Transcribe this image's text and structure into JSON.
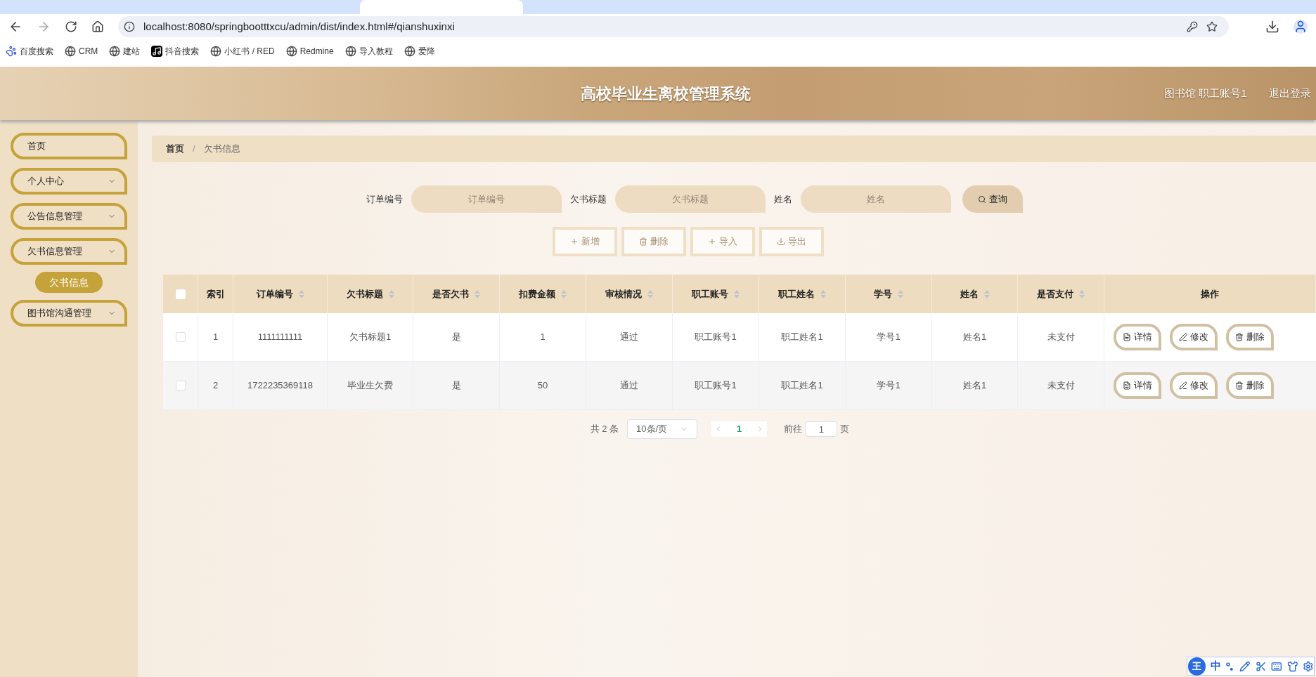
{
  "browser": {
    "url": "localhost:8080/springbootttxcu/admin/dist/index.html#/qianshuxinxi",
    "bookmarks": [
      {
        "kind": "paw",
        "label": "百度搜索"
      },
      {
        "kind": "globe",
        "label": "CRM"
      },
      {
        "kind": "globe",
        "label": "建站"
      },
      {
        "kind": "note",
        "label": "抖音搜索"
      },
      {
        "kind": "globe",
        "label": "小红书 / RED"
      },
      {
        "kind": "globe",
        "label": "Redmine"
      },
      {
        "kind": "globe",
        "label": "导入教程"
      },
      {
        "kind": "globe",
        "label": "爱降"
      }
    ]
  },
  "header": {
    "title": "高校毕业生离校管理系统",
    "user": "图书馆 职工账号1",
    "logout": "退出登录"
  },
  "sidebar": {
    "items": [
      {
        "label": "首页",
        "kind": "link"
      },
      {
        "label": "个人中心",
        "kind": "submenu"
      },
      {
        "label": "公告信息管理",
        "kind": "submenu"
      },
      {
        "label": "欠书信息管理",
        "kind": "submenu",
        "children": [
          {
            "label": "欠书信息",
            "selected": true
          }
        ]
      },
      {
        "label": "图书馆沟通管理",
        "kind": "submenu"
      }
    ]
  },
  "breadcrumb": {
    "items": [
      "首页",
      "欠书信息"
    ],
    "separator": "/"
  },
  "search": {
    "fields": [
      {
        "label": "订单编号",
        "placeholder": "订单编号"
      },
      {
        "label": "欠书标题",
        "placeholder": "欠书标题"
      },
      {
        "label": "姓名",
        "placeholder": "姓名"
      }
    ],
    "button": "查询"
  },
  "toolbar": [
    {
      "kind": "add",
      "label": "新增"
    },
    {
      "kind": "delete",
      "label": "删除"
    },
    {
      "kind": "import",
      "label": "导入"
    },
    {
      "kind": "export",
      "label": "导出"
    }
  ],
  "table": {
    "header_checked": false,
    "columns": [
      {
        "label": "索引",
        "sortable": false
      },
      {
        "label": "订单编号",
        "sortable": true
      },
      {
        "label": "欠书标题",
        "sortable": true
      },
      {
        "label": "是否欠书",
        "sortable": true
      },
      {
        "label": "扣费金额",
        "sortable": true
      },
      {
        "label": "审核情况",
        "sortable": true
      },
      {
        "label": "职工账号",
        "sortable": true
      },
      {
        "label": "职工姓名",
        "sortable": true
      },
      {
        "label": "学号",
        "sortable": true
      },
      {
        "label": "姓名",
        "sortable": true
      },
      {
        "label": "是否支付",
        "sortable": true
      },
      {
        "label": "操作",
        "sortable": false
      }
    ],
    "rows": [
      {
        "checked": false,
        "cells": [
          "1",
          "1111111111",
          "欠书标题1",
          "是",
          "1",
          "通过",
          "职工账号1",
          "职工姓名1",
          "学号1",
          "姓名1",
          "未支付"
        ],
        "actions": [
          {
            "kind": "detail",
            "label": "详情"
          },
          {
            "kind": "edit",
            "label": "修改"
          },
          {
            "kind": "delete",
            "label": "删除"
          }
        ]
      },
      {
        "checked": false,
        "cells": [
          "2",
          "1722235369118",
          "毕业生欠费",
          "是",
          "50",
          "通过",
          "职工账号1",
          "职工姓名1",
          "学号1",
          "姓名1",
          "未支付"
        ],
        "actions": [
          {
            "kind": "detail",
            "label": "详情"
          },
          {
            "kind": "edit",
            "label": "修改"
          },
          {
            "kind": "delete",
            "label": "删除"
          }
        ]
      }
    ]
  },
  "pagination": {
    "total": "共 2 条",
    "page_size": "10条/页",
    "pages": [
      {
        "label": "1",
        "selected": true
      }
    ],
    "goto": "前往",
    "goto_value": "1",
    "page_unit": "页"
  },
  "ime_toolbar": {
    "logo": "王",
    "mode": "中"
  }
}
